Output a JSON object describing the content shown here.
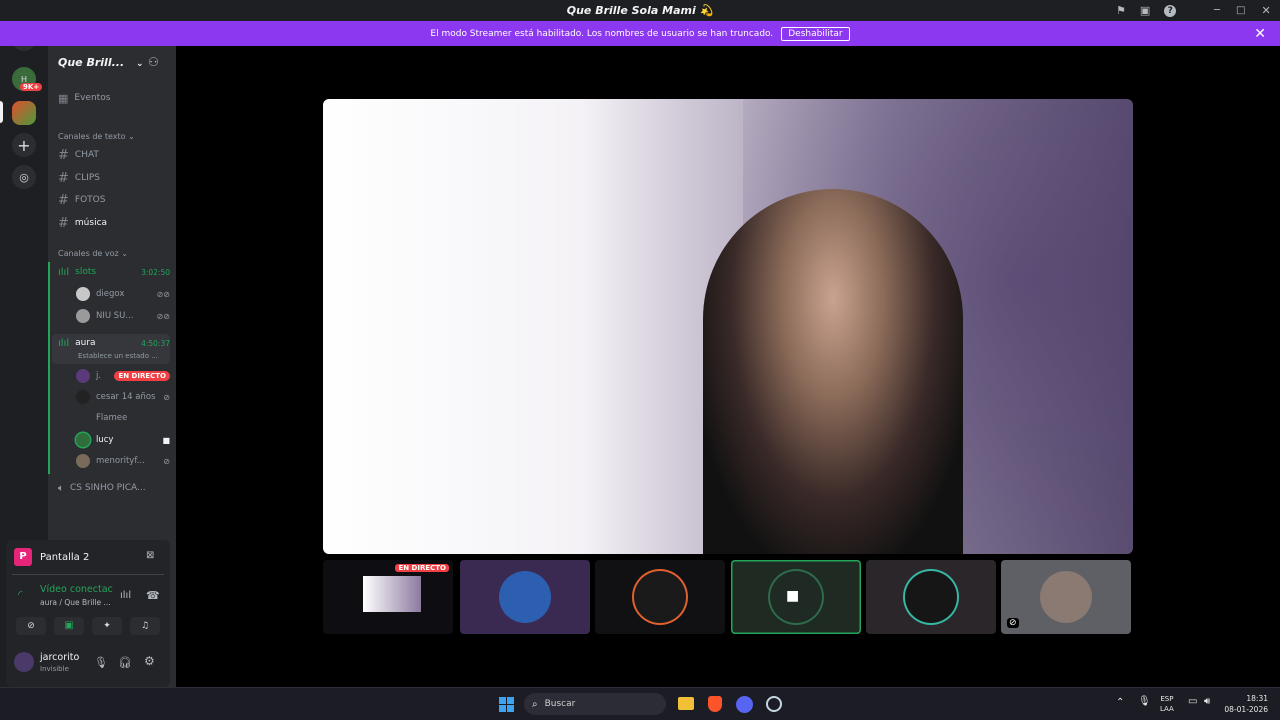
{
  "window": {
    "title": "Que Brille Sola Mami 💫"
  },
  "banner": {
    "text": "El modo Streamer está habilitado. Los nombres de usuario se han truncado.",
    "button": "Deshabilitar"
  },
  "server": {
    "name": "Que Brill..."
  },
  "events": {
    "label": "Eventos"
  },
  "text_category": {
    "label": "Canales de texto"
  },
  "text_channels": [
    {
      "name": "CHAT"
    },
    {
      "name": "CLIPS"
    },
    {
      "name": "FOTOS"
    },
    {
      "name": "música"
    }
  ],
  "voice_category": {
    "label": "Canales de voz"
  },
  "voice_channels": [
    {
      "name": "slots",
      "timer": "3:02:50",
      "users": [
        {
          "name": "diegox"
        },
        {
          "name": "NIU SU..."
        }
      ]
    },
    {
      "name": "aura",
      "timer": "4:50:37",
      "status": "Establece un estado ...",
      "users": [
        {
          "name": "j.",
          "badge": "EN DIRECTO"
        },
        {
          "name": "cesar 14 años"
        },
        {
          "name": "Flamee"
        },
        {
          "name": "lucy"
        },
        {
          "name": "menorityf..."
        }
      ]
    },
    {
      "name": "CS SINHO PICA..."
    }
  ],
  "guilds": {
    "badge": "9K+"
  },
  "stream_panel": {
    "title": "Pantalla 2",
    "avatar_letter": "P"
  },
  "voice_panel": {
    "status": "Vídeo conectac",
    "channel": "aura / Que Brille ..."
  },
  "user": {
    "name": "jarcorito",
    "status": "Invisible"
  },
  "tiles": {
    "live_badge": "EN DIRECTO"
  },
  "taskbar": {
    "search": "Buscar",
    "lang1": "ESP",
    "lang2": "LAA",
    "time": "18:31",
    "date": "08-01-2026"
  }
}
